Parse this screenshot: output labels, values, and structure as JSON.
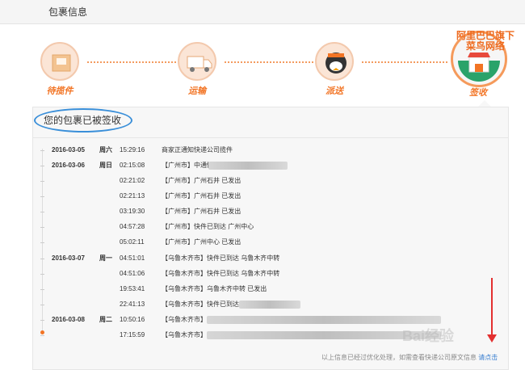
{
  "header": {
    "title": "包裹信息"
  },
  "steps": [
    {
      "label": "待揽件",
      "icon": "package-icon"
    },
    {
      "label": "运输",
      "icon": "truck-icon"
    },
    {
      "label": "派送",
      "icon": "courier-icon"
    },
    {
      "label": "签收",
      "icon": "store-icon"
    }
  ],
  "brand": {
    "line1": "阿里巴巴旗下",
    "line2": "菜鸟网络"
  },
  "status_title": "您的包裹已被签收",
  "rows": [
    {
      "date": "2016-03-05",
      "day": "周六",
      "time": "15:29:16",
      "msg": "商家正通知快递公司揽件"
    },
    {
      "date": "2016-03-06",
      "day": "周日",
      "time": "02:15:08",
      "msg": "【广州市】中通快递"
    },
    {
      "date": "",
      "day": "",
      "time": "02:21:02",
      "msg": "【广州市】广州石井 已发出"
    },
    {
      "date": "",
      "day": "",
      "time": "02:21:13",
      "msg": "【广州市】广州石井 已发出"
    },
    {
      "date": "",
      "day": "",
      "time": "03:19:30",
      "msg": "【广州市】广州石井 已发出"
    },
    {
      "date": "",
      "day": "",
      "time": "04:57:28",
      "msg": "【广州市】快件已到达 广州中心"
    },
    {
      "date": "",
      "day": "",
      "time": "05:02:11",
      "msg": "【广州市】广州中心 已发出"
    },
    {
      "date": "2016-03-07",
      "day": "周一",
      "time": "04:51:01",
      "msg": "【乌鲁木齐市】快件已到达 乌鲁木齐中转"
    },
    {
      "date": "",
      "day": "",
      "time": "04:51:06",
      "msg": "【乌鲁木齐市】快件已到达 乌鲁木齐中转"
    },
    {
      "date": "",
      "day": "",
      "time": "19:53:41",
      "msg": "【乌鲁木齐市】乌鲁木齐中转 已发出"
    },
    {
      "date": "",
      "day": "",
      "time": "22:41:13",
      "msg": "【乌鲁木齐市】快件已到达"
    },
    {
      "date": "2016-03-08",
      "day": "周二",
      "time": "10:50:16",
      "msg": "【乌鲁木齐市】"
    },
    {
      "date": "",
      "day": "",
      "time": "17:15:59",
      "msg": "【乌鲁木齐市】"
    }
  ],
  "footer": {
    "note": "以上信息已经过优化处理，如需查看快递公司原文信息",
    "link": "请点击"
  },
  "colors": {
    "accent": "#f27424",
    "highlight": "#3a8fd9",
    "arrow": "#e33030"
  }
}
